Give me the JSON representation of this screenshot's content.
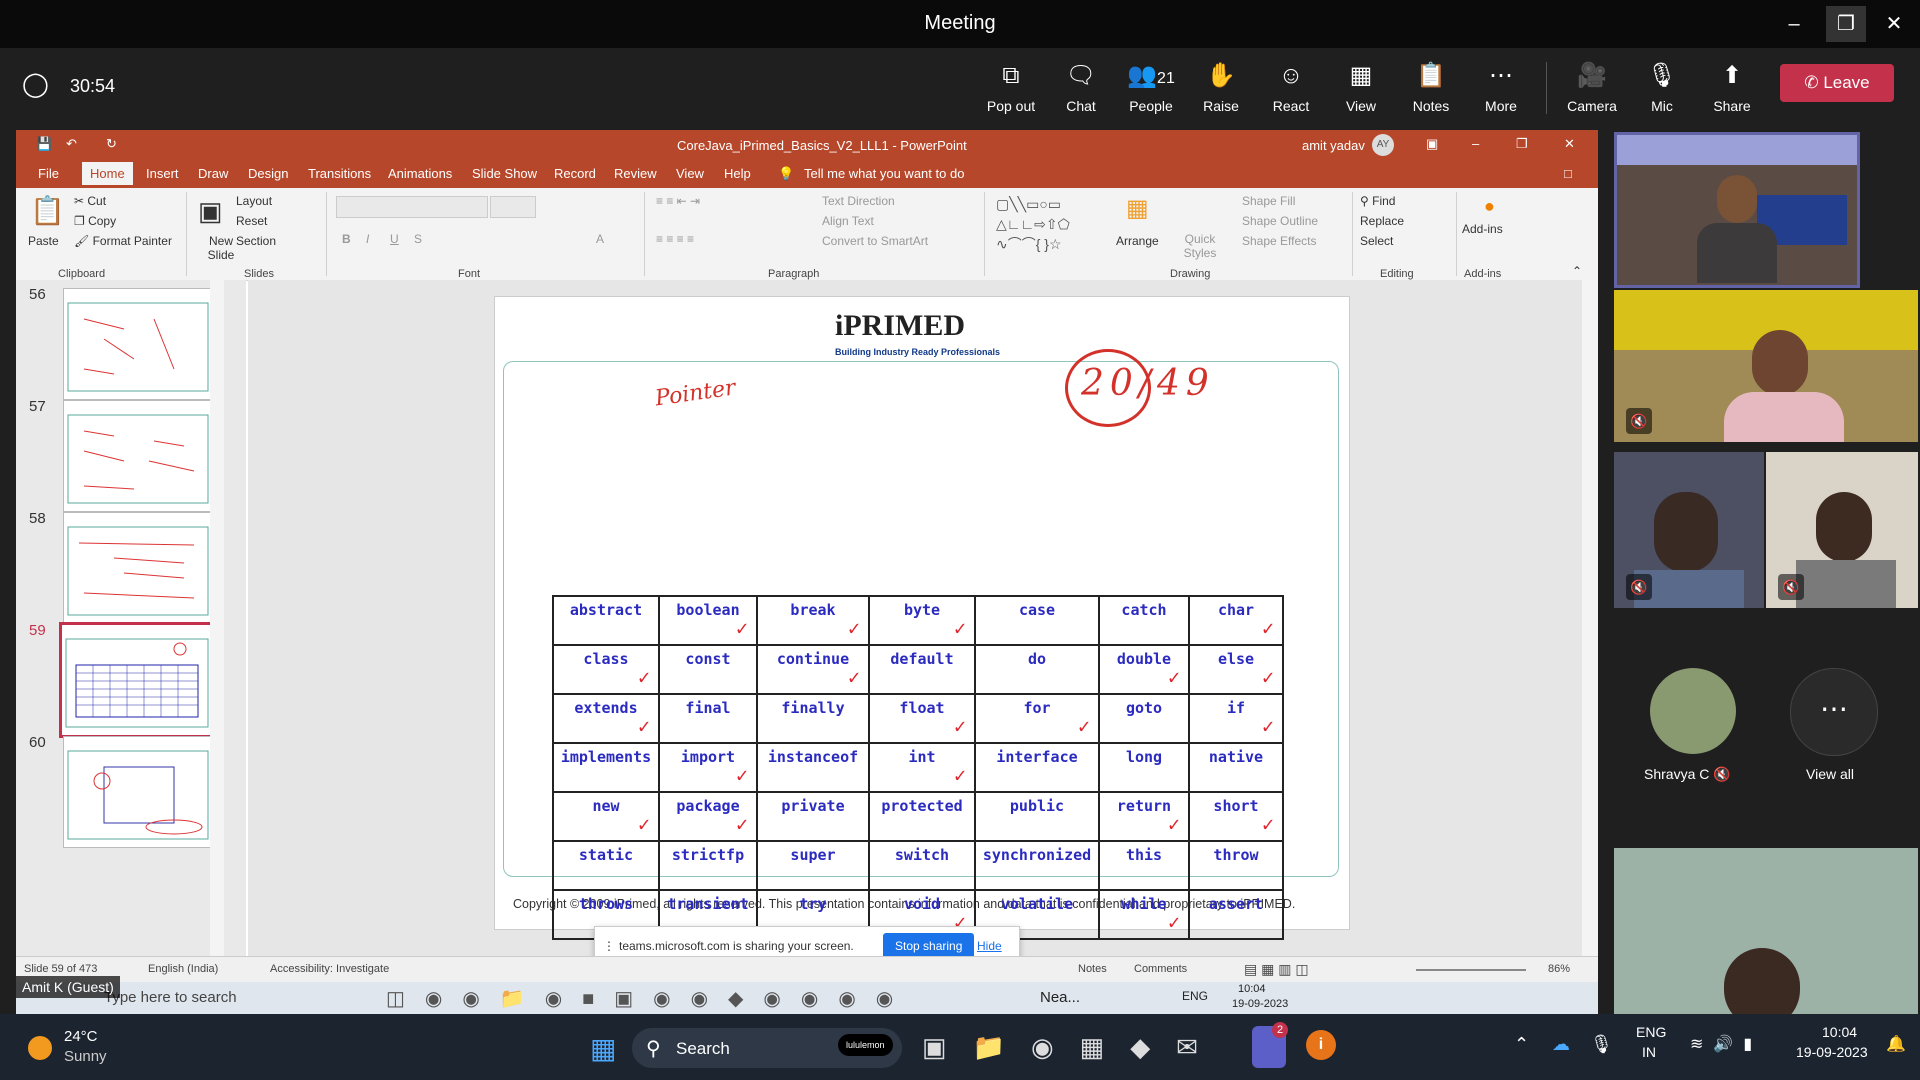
{
  "window": {
    "title": "Meeting"
  },
  "meeting": {
    "timer": "30:54",
    "toolbar": [
      {
        "label": "Pop out",
        "icon": "popout-icon"
      },
      {
        "label": "Chat",
        "icon": "chat-icon"
      },
      {
        "label": "People",
        "icon": "people-icon",
        "count": "21"
      },
      {
        "label": "Raise",
        "icon": "hand-icon"
      },
      {
        "label": "React",
        "icon": "smile-icon"
      },
      {
        "label": "View",
        "icon": "view-icon"
      },
      {
        "label": "Notes",
        "icon": "notes-icon"
      },
      {
        "label": "More",
        "icon": "more-icon"
      },
      {
        "label": "Camera",
        "icon": "camera-icon"
      },
      {
        "label": "Mic",
        "icon": "mic-off-icon"
      },
      {
        "label": "Share",
        "icon": "share-icon"
      }
    ],
    "leave_label": "Leave",
    "presenter_label": "Amit K (Guest)",
    "participants": [
      {
        "name": "Shravya C"
      },
      {
        "name": "View all"
      }
    ],
    "sharing_banner": {
      "text": "teams.microsoft.com is sharing your screen.",
      "stop": "Stop sharing",
      "hide": "Hide"
    }
  },
  "powerpoint": {
    "doc_title": "CoreJava_iPrimed_Basics_V2_LLL1  -  PowerPoint",
    "user": "amit yadav",
    "user_initials": "AY",
    "tabs": [
      "File",
      "Home",
      "Insert",
      "Draw",
      "Design",
      "Transitions",
      "Animations",
      "Slide Show",
      "Record",
      "Review",
      "View",
      "Help"
    ],
    "tell_me": "Tell me what you want to do",
    "ribbon": {
      "clipboard": {
        "paste": "Paste",
        "cut": "Cut",
        "copy": "Copy",
        "format_painter": "Format Painter",
        "group": "Clipboard"
      },
      "slides": {
        "new_slide": "New Slide",
        "layout": "Layout",
        "reset": "Reset",
        "section": "Section",
        "group": "Slides"
      },
      "font_group": "Font",
      "paragraph": {
        "text_direction": "Text Direction",
        "align_text": "Align Text",
        "convert": "Convert to SmartArt",
        "group": "Paragraph"
      },
      "drawing": {
        "arrange": "Arrange",
        "quick_styles": "Quick Styles",
        "shape_fill": "Shape Fill",
        "shape_outline": "Shape Outline",
        "shape_effects": "Shape Effects",
        "group": "Drawing"
      },
      "editing": {
        "find": "Find",
        "replace": "Replace",
        "select": "Select",
        "group": "Editing"
      },
      "addins": {
        "label": "Add-ins",
        "group": "Add-ins"
      }
    },
    "thumbnails": [
      "56",
      "57",
      "58",
      "59",
      "60"
    ],
    "selected_thumbnail": "59",
    "status": {
      "slide": "Slide 59 of 473",
      "language": "English (India)",
      "accessibility": "Accessibility: Investigate",
      "notes": "Notes",
      "comments": "Comments",
      "zoom": "86%"
    },
    "slide": {
      "logo": "iPRIMED",
      "tagline": "Building Industry Ready Professionals",
      "handwritten_label": "Pointer",
      "handwritten_score": "20/49",
      "footer": "Copyright © 2009 iPrimed, all rights reserved. This presentation contains information  and data  that is confidential and proprietary to iPRIMED.",
      "keywords": [
        [
          {
            "w": "abstract",
            "t": false
          },
          {
            "w": "boolean",
            "t": true
          },
          {
            "w": "break",
            "t": true
          },
          {
            "w": "byte",
            "t": true
          },
          {
            "w": "case",
            "t": false
          },
          {
            "w": "catch",
            "t": false
          },
          {
            "w": "char",
            "t": true
          }
        ],
        [
          {
            "w": "class",
            "t": true
          },
          {
            "w": "const",
            "t": false
          },
          {
            "w": "continue",
            "t": true
          },
          {
            "w": "default",
            "t": false
          },
          {
            "w": "do",
            "t": false
          },
          {
            "w": "double",
            "t": true
          },
          {
            "w": "else",
            "t": true
          }
        ],
        [
          {
            "w": "extends",
            "t": true
          },
          {
            "w": "final",
            "t": false
          },
          {
            "w": "finally",
            "t": false
          },
          {
            "w": "float",
            "t": true
          },
          {
            "w": "for",
            "t": true
          },
          {
            "w": "goto",
            "t": false
          },
          {
            "w": "if",
            "t": true
          }
        ],
        [
          {
            "w": "implements",
            "t": false
          },
          {
            "w": "import",
            "t": true
          },
          {
            "w": "instanceof",
            "t": false
          },
          {
            "w": "int",
            "t": true
          },
          {
            "w": "interface",
            "t": false
          },
          {
            "w": "long",
            "t": false
          },
          {
            "w": "native",
            "t": false
          }
        ],
        [
          {
            "w": "new",
            "t": true
          },
          {
            "w": "package",
            "t": true
          },
          {
            "w": "private",
            "t": false
          },
          {
            "w": "protected",
            "t": false
          },
          {
            "w": "public",
            "t": false
          },
          {
            "w": "return",
            "t": true
          },
          {
            "w": "short",
            "t": true
          }
        ],
        [
          {
            "w": "static",
            "t": false
          },
          {
            "w": "strictfp",
            "t": false
          },
          {
            "w": "super",
            "t": false
          },
          {
            "w": "switch",
            "t": false
          },
          {
            "w": "synchronized",
            "t": false
          },
          {
            "w": "this",
            "t": false
          },
          {
            "w": "throw",
            "t": false
          }
        ],
        [
          {
            "w": "throws",
            "t": false
          },
          {
            "w": "transient",
            "t": false
          },
          {
            "w": "try",
            "t": false
          },
          {
            "w": "void",
            "t": true
          },
          {
            "w": "volatile",
            "t": false
          },
          {
            "w": "while",
            "t": true
          },
          {
            "w": "assert",
            "t": false
          }
        ]
      ]
    },
    "inner_taskbar": {
      "search": "Type here to search",
      "weather": "Nea...",
      "lang": "ENG",
      "time": "10:04",
      "date": "19-09-2023"
    }
  },
  "taskbar": {
    "weather_temp": "24°C",
    "weather_desc": "Sunny",
    "search": "Search",
    "search_badge": "lululemon",
    "lang_top": "ENG",
    "lang_bottom": "IN",
    "time": "10:04",
    "date": "19-09-2023",
    "teams_badge": "2"
  }
}
